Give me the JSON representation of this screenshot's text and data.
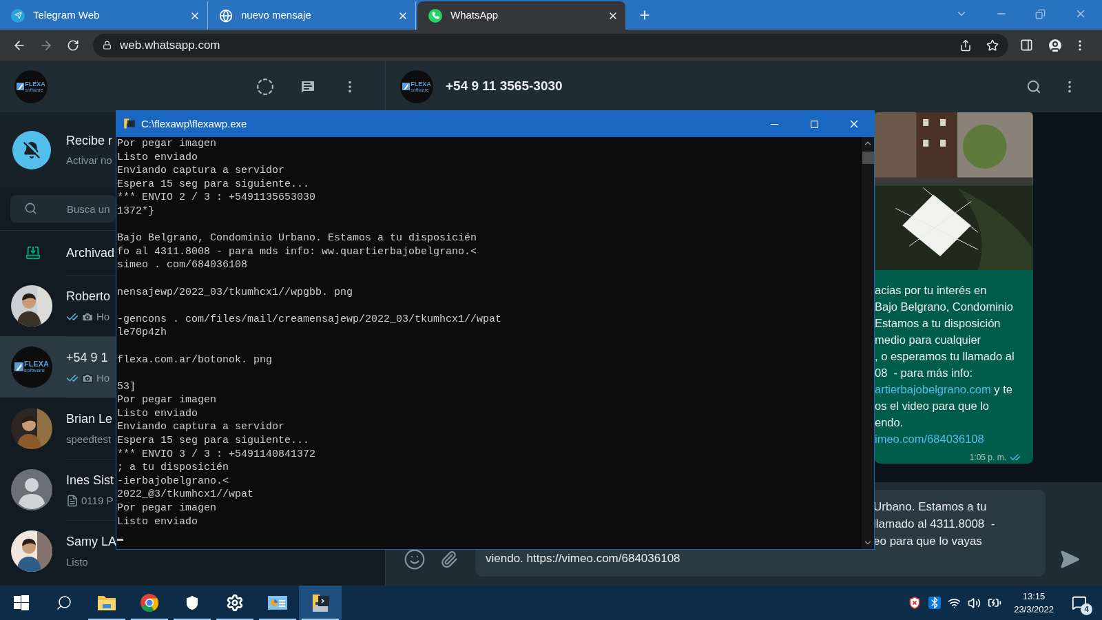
{
  "browser": {
    "tabs": [
      {
        "kind": "telegram",
        "title": "Telegram Web",
        "selected": false
      },
      {
        "kind": "globe",
        "title": "nuevo mensaje",
        "selected": false
      },
      {
        "kind": "whatsapp",
        "title": "WhatsApp",
        "selected": true
      }
    ],
    "url": "web.whatsapp.com"
  },
  "whatsapp": {
    "profile_logo": {
      "text": "FLEXA",
      "subtext": "software"
    },
    "banner": {
      "title": "Recibe r",
      "subtitle": "Activar no"
    },
    "search": {
      "placeholder": "Busca un"
    },
    "archived": "Archivad",
    "chats": [
      {
        "kind": "picture",
        "name": "Roberto",
        "preview": "Ho",
        "read_receipt": true,
        "photo": true,
        "document": false,
        "selected": false
      },
      {
        "kind": "logo",
        "logo": {
          "text": "FLEXA",
          "subtext": "software"
        },
        "name": "+54 9 1",
        "preview": "Ho",
        "read_receipt": true,
        "photo": true,
        "document": false,
        "selected": true
      },
      {
        "kind": "picture",
        "name": "Brian Le",
        "preview": "speedtest",
        "read_receipt": false,
        "photo": false,
        "document": false,
        "selected": false
      },
      {
        "kind": "default",
        "name": "Ines Sist",
        "preview": "0119 P",
        "read_receipt": false,
        "photo": false,
        "document": true,
        "selected": false
      },
      {
        "kind": "picture",
        "name": "Samy LA",
        "preview": "Listo",
        "read_receipt": false,
        "photo": false,
        "document": false,
        "selected": false
      }
    ],
    "chat": {
      "logo": {
        "text": "FLEXA",
        "subtext": "software"
      },
      "contact": "+54 9 11 3565-3030",
      "message": {
        "lines": [
          {
            "kind": "text",
            "text": "acias por tu interés en"
          },
          {
            "kind": "text",
            "text": "Bajo Belgrano, Condominio"
          },
          {
            "kind": "text",
            "text": "Estamos a tu disposición"
          },
          {
            "kind": "text",
            "text": "medio para cualquier"
          },
          {
            "kind": "text",
            "text": ", o esperamos tu llamado al"
          },
          {
            "kind": "text",
            "text": "08  - para más info:"
          },
          {
            "kind": "link_text",
            "link": "artierbajobelgrano.com",
            "text": " y te"
          },
          {
            "kind": "text",
            "text": "os el video para que lo"
          },
          {
            "kind": "text",
            "text": "endo."
          },
          {
            "kind": "link",
            "link": "imeo.com/684036108"
          }
        ],
        "time": "1:05 p. m.",
        "read": true
      },
      "draft": [
        {
          "kind": "cut",
          "text": "Urbano. Estamos a tu"
        },
        {
          "kind": "cut",
          "text": "llamado al 4311.8008  -"
        },
        {
          "kind": "cut",
          "text": "eo para que lo vayas"
        },
        {
          "kind": "full",
          "text": "viendo. https://vimeo.com/684036108"
        }
      ]
    }
  },
  "console": {
    "title": "C:\\flexawp\\flexawp.exe",
    "lines": [
      {
        "kind": "text",
        "text": "Por pegar imagen"
      },
      {
        "kind": "text",
        "text": "Listo enviado"
      },
      {
        "kind": "text",
        "text": "Enviando captura a servidor"
      },
      {
        "kind": "text",
        "text": "Espera 15 seg para siguiente..."
      },
      {
        "kind": "text",
        "text": "*** ENVIO 2 / 3 : +5491135653030"
      },
      {
        "kind": "text",
        "text": "1372*}"
      },
      {
        "kind": "blank"
      },
      {
        "kind": "text",
        "text": "Bajo Belgrano, Condominio Urbano. Estamos a tu disposicién"
      },
      {
        "kind": "text",
        "text": "fo al 4311.8008 - para mds info: ww.quartierbajobelgrano.<"
      },
      {
        "kind": "text",
        "text": "simeo . com/684036108"
      },
      {
        "kind": "blank"
      },
      {
        "kind": "text",
        "text": "nensajewp/2022_03/tkumhcx1//wpgbb. png"
      },
      {
        "kind": "blank"
      },
      {
        "kind": "text",
        "text": "-gencons . com/files/mail/creamensajewp/2022_03/tkumhcx1//wpat"
      },
      {
        "kind": "text",
        "text": "le70p4zh"
      },
      {
        "kind": "blank"
      },
      {
        "kind": "text",
        "text": "flexa.com.ar/botonok. png"
      },
      {
        "kind": "blank"
      },
      {
        "kind": "text",
        "text": "53]"
      },
      {
        "kind": "text",
        "text": "Por pegar imagen"
      },
      {
        "kind": "text",
        "text": "Listo enviado"
      },
      {
        "kind": "text",
        "text": "Enviando captura a servidor"
      },
      {
        "kind": "text",
        "text": "Espera 15 seg para siguiente..."
      },
      {
        "kind": "text",
        "text": "*** ENVIO 3 / 3 : +5491140841372"
      },
      {
        "kind": "text",
        "text": "; a tu disposicién"
      },
      {
        "kind": "text",
        "text": "-ierbajobelgrano.<"
      },
      {
        "kind": "text",
        "text": "2022_@3/tkumhcx1//wpat"
      },
      {
        "kind": "text",
        "text": "Por pegar imagen"
      },
      {
        "kind": "text",
        "text": "Listo enviado"
      },
      {
        "kind": "cursor"
      }
    ]
  },
  "taskbar": {
    "apps": [
      {
        "kind": "start",
        "open": false,
        "selected": false
      },
      {
        "kind": "search",
        "open": false,
        "selected": false
      },
      {
        "kind": "explorer",
        "open": true,
        "selected": false
      },
      {
        "kind": "chrome",
        "open": true,
        "selected": false
      },
      {
        "kind": "security",
        "open": true,
        "selected": false
      },
      {
        "kind": "settings",
        "open": true,
        "selected": false
      },
      {
        "kind": "control",
        "open": true,
        "selected": false
      },
      {
        "kind": "python",
        "open": true,
        "selected": true
      }
    ],
    "time": "13:15",
    "date": "23/3/2022",
    "notifications": "4"
  }
}
